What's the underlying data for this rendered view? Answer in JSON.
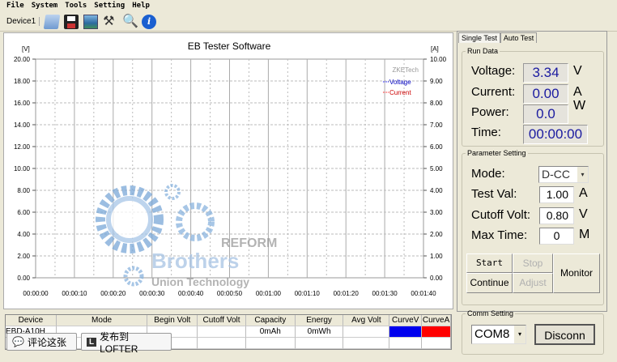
{
  "menu": [
    "File",
    "System",
    "Tools",
    "Setting",
    "Help"
  ],
  "toolbar": {
    "device_tab": "Device1",
    "icons": [
      "open-folder-icon",
      "save-icon",
      "chart-image-icon",
      "tools-icon",
      "search-icon",
      "info-icon"
    ]
  },
  "chart": {
    "title": "EB Tester Software",
    "left_unit": "[V]",
    "right_unit": "[A]",
    "left_ticks": [
      "20.00",
      "18.00",
      "16.00",
      "14.00",
      "12.00",
      "10.00",
      "8.00",
      "6.00",
      "4.00",
      "2.00",
      "0.00"
    ],
    "right_ticks": [
      "10.00",
      "9.00",
      "8.00",
      "7.00",
      "6.00",
      "5.00",
      "4.00",
      "3.00",
      "2.00",
      "1.00",
      "0.00"
    ],
    "x_ticks": [
      "00:00:00",
      "00:00:10",
      "00:00:20",
      "00:00:30",
      "00:00:40",
      "00:00:50",
      "00:01:00",
      "00:01:10",
      "00:01:20",
      "00:01:30",
      "00:01:40"
    ],
    "legend": {
      "brand": "ZKETech",
      "voltage": "Voltage",
      "current": "Current"
    },
    "colors": {
      "voltage": "#0000ff",
      "current": "#ff0000"
    },
    "watermark": {
      "line1": "REFORM",
      "line2": "Brothers",
      "line3": "Union Technology"
    }
  },
  "chart_data": {
    "type": "line",
    "title": "EB Tester Software",
    "xlabel": "",
    "ylabel": "[V]",
    "y2label": "[A]",
    "xlim": [
      "00:00:00",
      "00:01:40"
    ],
    "ylim": [
      0,
      20
    ],
    "y2lim": [
      0,
      10
    ],
    "grid": true,
    "legend": "top-right",
    "series": [
      {
        "name": "Voltage",
        "values": []
      },
      {
        "name": "Current",
        "values": []
      }
    ]
  },
  "table": {
    "headers": [
      "Device",
      "Mode",
      "Begin Volt",
      "Cutoff Volt",
      "Capacity",
      "Energy",
      "Avg Volt",
      "CurveV",
      "CurveA"
    ],
    "rows": [
      [
        "EBD-A10H",
        "",
        "",
        "",
        "0mAh",
        "0mWh",
        "",
        "",
        ""
      ]
    ],
    "curve_colors": [
      "#0000ee",
      "#ff0000"
    ]
  },
  "overlay": {
    "comment": "评论这张",
    "publish": "发布到LOFTER",
    "publish_badge": "L"
  },
  "panel": {
    "tabs": [
      "Single Test",
      "Auto Test"
    ],
    "run_data": {
      "legend": "Run Data",
      "voltage_label": "Voltage:",
      "voltage": "3.34",
      "voltage_unit": "V",
      "current_label": "Current:",
      "current": "0.00",
      "current_unit": "A",
      "power_label": "Power:",
      "power": "0.0",
      "power_unit": "W",
      "time_label": "Time:",
      "time": "00:00:00"
    },
    "params": {
      "legend": "Parameter Setting",
      "mode_label": "Mode:",
      "mode": "D-CC",
      "test_label": "Test Val:",
      "test_val": "1.00",
      "test_unit": "A",
      "cutoff_label": "Cutoff Volt:",
      "cutoff": "0.80",
      "cutoff_unit": "V",
      "maxtime_label": "Max Time:",
      "maxtime": "0",
      "maxtime_unit": "M"
    },
    "buttons": {
      "start": "Start",
      "stop": "Stop",
      "continue": "Continue",
      "adjust": "Adjust",
      "monitor": "Monitor"
    },
    "comm": {
      "legend": "Comm Setting",
      "port": "COM8",
      "disconnect": "Disconn"
    }
  }
}
